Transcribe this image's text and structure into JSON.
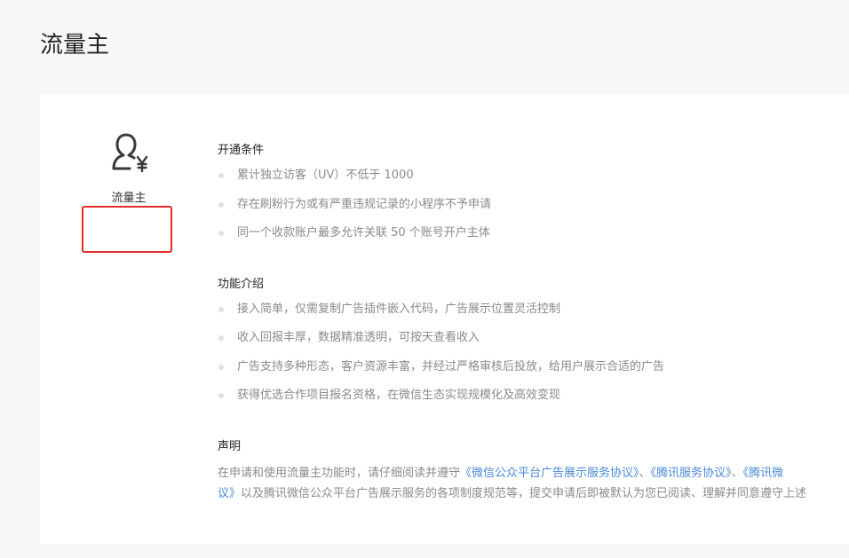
{
  "page": {
    "title": "流量主"
  },
  "card": {
    "role_label": "流量主",
    "sections": {
      "conditions": {
        "title": "开通条件",
        "items": [
          "累计独立访客（UV）不低于 1000",
          "存在刷粉行为或有严重违规记录的小程序不予申请",
          "同一个收款账户最多允许关联 50 个账号开户主体"
        ]
      },
      "features": {
        "title": "功能介绍",
        "items": [
          "接入简单，仅需复制广告插件嵌入代码，广告展示位置灵活控制",
          "收入回报丰厚，数据精准透明，可按天查看收入",
          "广告支持多种形态，客户资源丰富，并经过严格审核后投放，给用户展示合适的广告",
          "获得优选合作项目报名资格，在微信生态实现规模化及高效变现"
        ]
      },
      "statement": {
        "title": "声明",
        "line1_prefix": "在申请和使用流量主功能时，请仔细阅读并遵守",
        "link1": "《微信公众平台广告展示服务协议》",
        "sep1": "、",
        "link2": "《腾讯服务协议》",
        "sep2": "、",
        "link3_part1": "《腾讯微",
        "link3_part2": "议》",
        "line2_suffix": "以及腾讯微信公众平台广告展示服务的各项制度规范等，提交申请后即被默认为您已阅读、理解并同意遵守上述"
      }
    }
  },
  "colors": {
    "link": "#4a8ad7",
    "highlight_border": "#e22b2b"
  },
  "icons": {
    "role_icon": "user-yen-icon"
  }
}
